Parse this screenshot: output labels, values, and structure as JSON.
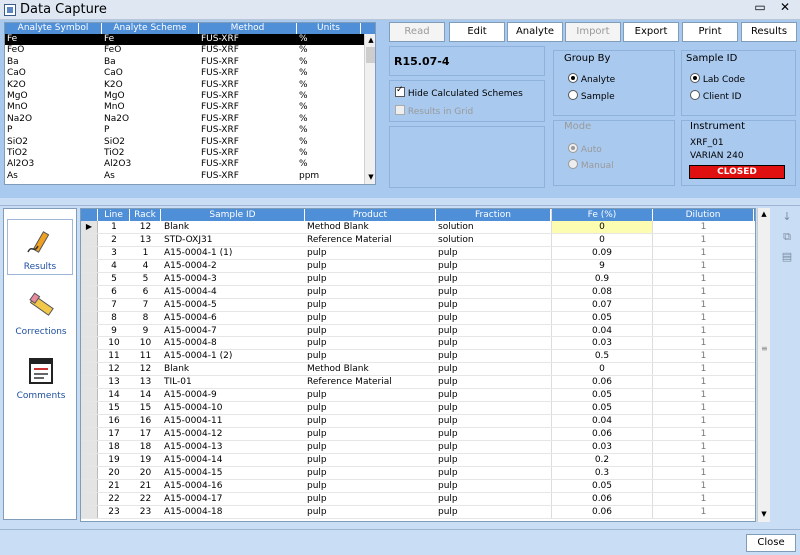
{
  "window": {
    "title": "Data Capture"
  },
  "analyte_table": {
    "headers": [
      "Analyte Symbol",
      "Analyte Scheme",
      "Method",
      "Units"
    ],
    "rows": [
      [
        "Fe",
        "Fe",
        "FUS-XRF",
        "%"
      ],
      [
        "FeO",
        "FeO",
        "FUS-XRF",
        "%"
      ],
      [
        "Ba",
        "Ba",
        "FUS-XRF",
        "%"
      ],
      [
        "CaO",
        "CaO",
        "FUS-XRF",
        "%"
      ],
      [
        "K2O",
        "K2O",
        "FUS-XRF",
        "%"
      ],
      [
        "MgO",
        "MgO",
        "FUS-XRF",
        "%"
      ],
      [
        "MnO",
        "MnO",
        "FUS-XRF",
        "%"
      ],
      [
        "Na2O",
        "Na2O",
        "FUS-XRF",
        "%"
      ],
      [
        "P",
        "P",
        "FUS-XRF",
        "%"
      ],
      [
        "SiO2",
        "SiO2",
        "FUS-XRF",
        "%"
      ],
      [
        "TiO2",
        "TiO2",
        "FUS-XRF",
        "%"
      ],
      [
        "Al2O3",
        "Al2O3",
        "FUS-XRF",
        "%"
      ],
      [
        "As",
        "As",
        "FUS-XRF",
        "ppm"
      ]
    ]
  },
  "toolbar": {
    "read": "Read",
    "edit": "Edit",
    "analyte": "Analyte",
    "import": "Import",
    "export": "Export",
    "print": "Print",
    "results": "Results"
  },
  "batch": {
    "id": "R15.07-4"
  },
  "options": {
    "hide_calc": "Hide Calculated Schemes",
    "results_grid": "Results in Grid"
  },
  "group_by": {
    "title": "Group By",
    "analyte": "Analyte",
    "sample": "Sample"
  },
  "sample_id": {
    "title": "Sample ID",
    "lab_code": "Lab Code",
    "client_id": "Client ID"
  },
  "mode": {
    "title": "Mode",
    "auto": "Auto",
    "manual": "Manual"
  },
  "instrument": {
    "title": "Instrument",
    "name": "XRF_01",
    "model": "VARIAN 240",
    "status": "CLOSED",
    "status_color": "#e01010"
  },
  "sidebar": {
    "results": "Results",
    "corrections": "Corrections",
    "comments": "Comments"
  },
  "grid": {
    "headers": [
      "Line",
      "Rack",
      "Sample ID",
      "Product",
      "Fraction",
      "Fe (%)",
      "Dilution"
    ],
    "rows": [
      [
        "1",
        "12",
        "Blank",
        "Method Blank",
        "solution",
        "0",
        "1"
      ],
      [
        "2",
        "13",
        "STD-OXJ31",
        "Reference Material",
        "solution",
        "0",
        "1"
      ],
      [
        "3",
        "1",
        "A15-0004-1 (1)",
        "pulp",
        "pulp",
        "0.09",
        "1"
      ],
      [
        "4",
        "4",
        "A15-0004-2",
        "pulp",
        "pulp",
        "9",
        "1"
      ],
      [
        "5",
        "5",
        "A15-0004-3",
        "pulp",
        "pulp",
        "0.9",
        "1"
      ],
      [
        "6",
        "6",
        "A15-0004-4",
        "pulp",
        "pulp",
        "0.08",
        "1"
      ],
      [
        "7",
        "7",
        "A15-0004-5",
        "pulp",
        "pulp",
        "0.07",
        "1"
      ],
      [
        "8",
        "8",
        "A15-0004-6",
        "pulp",
        "pulp",
        "0.05",
        "1"
      ],
      [
        "9",
        "9",
        "A15-0004-7",
        "pulp",
        "pulp",
        "0.04",
        "1"
      ],
      [
        "10",
        "10",
        "A15-0004-8",
        "pulp",
        "pulp",
        "0.03",
        "1"
      ],
      [
        "11",
        "11",
        "A15-0004-1 (2)",
        "pulp",
        "pulp",
        "0.5",
        "1"
      ],
      [
        "12",
        "12",
        "Blank",
        "Method Blank",
        "pulp",
        "0",
        "1"
      ],
      [
        "13",
        "13",
        "TIL-01",
        "Reference Material",
        "pulp",
        "0.06",
        "1"
      ],
      [
        "14",
        "14",
        "A15-0004-9",
        "pulp",
        "pulp",
        "0.05",
        "1"
      ],
      [
        "15",
        "15",
        "A15-0004-10",
        "pulp",
        "pulp",
        "0.05",
        "1"
      ],
      [
        "16",
        "16",
        "A15-0004-11",
        "pulp",
        "pulp",
        "0.04",
        "1"
      ],
      [
        "17",
        "17",
        "A15-0004-12",
        "pulp",
        "pulp",
        "0.06",
        "1"
      ],
      [
        "18",
        "18",
        "A15-0004-13",
        "pulp",
        "pulp",
        "0.03",
        "1"
      ],
      [
        "19",
        "19",
        "A15-0004-14",
        "pulp",
        "pulp",
        "0.2",
        "1"
      ],
      [
        "20",
        "20",
        "A15-0004-15",
        "pulp",
        "pulp",
        "0.3",
        "1"
      ],
      [
        "21",
        "21",
        "A15-0004-16",
        "pulp",
        "pulp",
        "0.05",
        "1"
      ],
      [
        "22",
        "22",
        "A15-0004-17",
        "pulp",
        "pulp",
        "0.06",
        "1"
      ],
      [
        "23",
        "23",
        "A15-0004-18",
        "pulp",
        "pulp",
        "0.06",
        "1"
      ]
    ]
  },
  "footer": {
    "close": "Close"
  }
}
